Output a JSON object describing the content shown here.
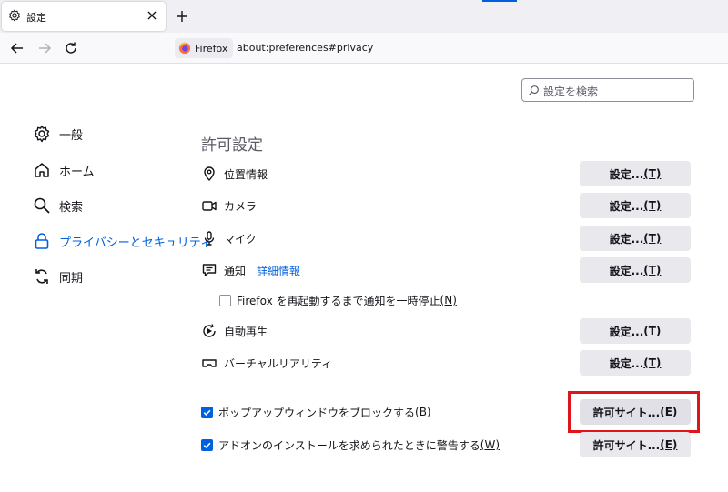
{
  "tab": {
    "title": "設定"
  },
  "identity": {
    "label": "Firefox"
  },
  "urlbar": {
    "url": "about:preferences#privacy"
  },
  "search": {
    "placeholder": "設定を検索"
  },
  "sidebar": {
    "items": [
      {
        "label": "一般",
        "icon": "gear-icon"
      },
      {
        "label": "ホーム",
        "icon": "home-icon"
      },
      {
        "label": "検索",
        "icon": "search-icon"
      },
      {
        "label": "プライバシーとセキュリティ",
        "icon": "lock-icon",
        "active": true
      },
      {
        "label": "同期",
        "icon": "sync-icon"
      }
    ]
  },
  "permissions": {
    "title": "許可設定",
    "rows": [
      {
        "label": "位置情報",
        "icon": "location-icon",
        "button": "設定...",
        "accesskey": "(T)"
      },
      {
        "label": "カメラ",
        "icon": "camera-icon",
        "button": "設定...",
        "accesskey": "(T)"
      },
      {
        "label": "マイク",
        "icon": "microphone-icon",
        "button": "設定...",
        "accesskey": "(T)"
      },
      {
        "label": "通知",
        "icon": "notification-icon",
        "link": "詳細情報",
        "button": "設定...",
        "accesskey": "(T)"
      },
      {
        "label": "自動再生",
        "icon": "autoplay-icon",
        "button": "設定...",
        "accesskey": "(T)"
      },
      {
        "label": "バーチャルリアリティ",
        "icon": "vr-icon",
        "button": "設定...",
        "accesskey": "(T)"
      }
    ],
    "pause_notifications": {
      "label": "Firefox を再起動するまで通知を一時停止",
      "accesskey": "(N)",
      "checked": false
    },
    "block_popups": {
      "label": "ポップアップウィンドウをブロックする",
      "accesskey": "(B)",
      "checked": true,
      "button": "許可サイト...",
      "button_accesskey": "(E)"
    },
    "addon_warn": {
      "label": "アドオンのインストールを求められたときに警告する",
      "accesskey": "(W)",
      "checked": true,
      "button": "許可サイト...",
      "button_accesskey": "(E)"
    }
  },
  "colors": {
    "accent": "#0061e0",
    "highlight": "#e0151b"
  }
}
